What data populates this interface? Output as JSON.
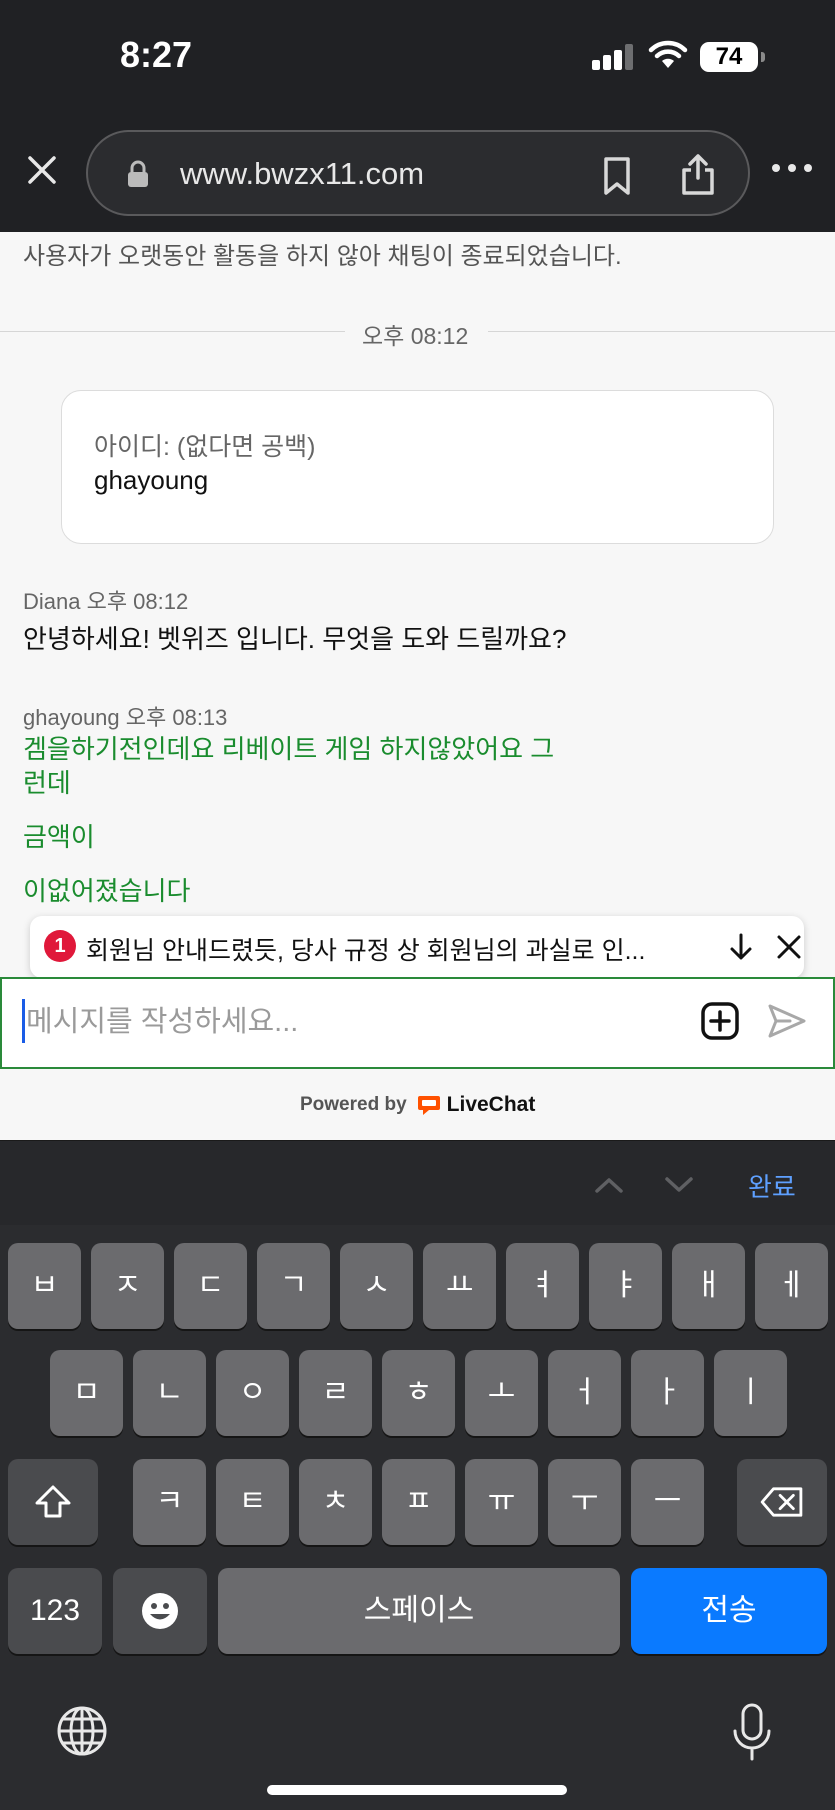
{
  "status_bar": {
    "time": "8:27",
    "battery": "74"
  },
  "browser": {
    "url": "www.bwzx11.com"
  },
  "chat": {
    "system_message": "사용자가 오랫동안 활동을 하지 않아 채팅이 종료되었습니다.",
    "divider_time": "오후 08:12",
    "form": {
      "label": "아이디: (없다면 공백)",
      "value": "ghayoung"
    },
    "messages": [
      {
        "meta": "Diana 오후 08:12",
        "lines": [
          "안녕하세요! 벳위즈 입니다. 무엇을 도와 드릴까요?"
        ]
      },
      {
        "meta": "ghayoung 오후 08:13",
        "lines": [
          "겜을하기전인데요 리베이트 게임 하지않았어요 그",
          "런데",
          "금액이",
          "이없어졌습니다"
        ]
      }
    ],
    "notification": {
      "count": "1",
      "text": "회원님 안내드렸듯, 당사 규정 상 회원님의 과실로 인..."
    },
    "composer": {
      "placeholder": "메시지를 작성하세요..."
    },
    "powered_by": "Powered by",
    "brand": "LiveChat"
  },
  "keyboard_bar": {
    "done": "완료"
  },
  "keyboard": {
    "row1": [
      "ㅂ",
      "ㅈ",
      "ㄷ",
      "ㄱ",
      "ㅅ",
      "ㅛ",
      "ㅕ",
      "ㅑ",
      "ㅐ",
      "ㅔ"
    ],
    "row2": [
      "ㅁ",
      "ㄴ",
      "ㅇ",
      "ㄹ",
      "ㅎ",
      "ㅗ",
      "ㅓ",
      "ㅏ",
      "ㅣ"
    ],
    "row3": [
      "ㅋ",
      "ㅌ",
      "ㅊ",
      "ㅍ",
      "ㅠ",
      "ㅜ",
      "ㅡ"
    ],
    "numbers": "123",
    "space": "스페이스",
    "send": "전송"
  },
  "colors": {
    "user_text": "#1a8c2e",
    "accent_blue": "#0a7aff",
    "notif_badge": "#e0183a"
  }
}
